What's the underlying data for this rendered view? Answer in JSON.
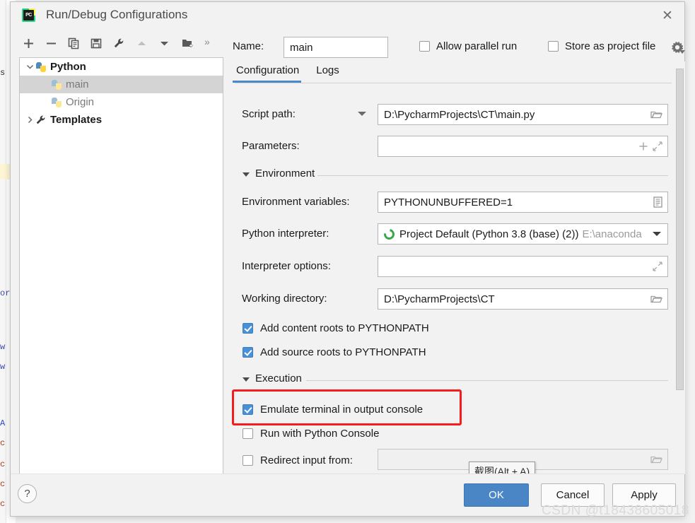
{
  "window": {
    "title": "Run/Debug Configurations",
    "app_icon": "pycharm-icon",
    "app_icon_text": "PC",
    "close_icon": "close-icon"
  },
  "toolbar": {
    "buttons": [
      {
        "name": "add-configuration-button",
        "icon": "plus-icon"
      },
      {
        "name": "remove-configuration-button",
        "icon": "minus-icon"
      },
      {
        "name": "copy-configuration-button",
        "icon": "copy-icon"
      },
      {
        "name": "save-configuration-button",
        "icon": "save-icon"
      },
      {
        "name": "edit-templates-button",
        "icon": "wrench-icon"
      },
      {
        "name": "move-up-button",
        "icon": "arrow-up-icon"
      },
      {
        "name": "move-down-button",
        "icon": "arrow-down-icon"
      },
      {
        "name": "new-folder-button",
        "icon": "new-folder-icon"
      }
    ],
    "overflow_label": "»"
  },
  "header": {
    "name_label": "Name:",
    "name_value": "main",
    "name_placeholder": "",
    "allow_parallel_run_label": "Allow parallel run",
    "allow_parallel_run_checked": false,
    "store_as_project_file_label": "Store as project file",
    "store_as_project_file_checked": false,
    "gear_icon": "gear-icon"
  },
  "tree": {
    "items": [
      {
        "label": "Python",
        "depth": 0,
        "twisty": "chevron-down",
        "icon": "python-icon",
        "selected": false,
        "bold": true
      },
      {
        "label": "main",
        "depth": 1,
        "twisty": "",
        "icon": "python-icon-dim",
        "selected": true,
        "bold": false
      },
      {
        "label": "Origin",
        "depth": 1,
        "twisty": "",
        "icon": "python-icon-dim",
        "selected": false,
        "bold": false
      },
      {
        "label": "Templates",
        "depth": 0,
        "twisty": "chevron-right",
        "icon": "wrench-icon",
        "selected": false,
        "bold": true
      }
    ]
  },
  "tabs": [
    {
      "label": "Configuration",
      "active": true
    },
    {
      "label": "Logs",
      "active": false
    }
  ],
  "form": {
    "script_path": {
      "label": "Script path:",
      "value": "D:\\PycharmProjects\\CT\\main.py",
      "combo_icon": "chevron-down-icon",
      "browse_icon": "folder-icon"
    },
    "parameters": {
      "label": "Parameters:",
      "value": "",
      "macro_icon": "plus-icon",
      "expand_icon": "expand-icon"
    },
    "environment_section": {
      "title": "Environment",
      "expanded": true,
      "twisty_icon": "triangle-down-icon"
    },
    "environment_variables": {
      "label": "Environment variables:",
      "value": "PYTHONUNBUFFERED=1",
      "browse_icon": "list-edit-icon"
    },
    "python_interpreter": {
      "label": "Python interpreter:",
      "value": "Project Default (Python 3.8 (base) (2))",
      "value_path": "E:\\anaconda",
      "status_icon": "conda-circle-icon",
      "dropdown_icon": "chevron-down-icon"
    },
    "interpreter_options": {
      "label": "Interpreter options:",
      "value": "",
      "expand_icon": "expand-icon"
    },
    "working_directory": {
      "label": "Working directory:",
      "value": "D:\\PycharmProjects\\CT",
      "browse_icon": "folder-icon"
    },
    "add_content_roots": {
      "label": "Add content roots to PYTHONPATH",
      "checked": true
    },
    "add_source_roots": {
      "label": "Add source roots to PYTHONPATH",
      "checked": true
    },
    "execution_section": {
      "title": "Execution",
      "expanded": true,
      "twisty_icon": "triangle-down-icon"
    },
    "emulate_terminal": {
      "label": "Emulate terminal in output console",
      "checked": true,
      "highlighted": true
    },
    "run_with_python_console": {
      "label": "Run with Python Console",
      "checked": false
    },
    "redirect_input": {
      "label": "Redirect input from:",
      "checked": false,
      "value": "",
      "browse_icon": "folder-icon"
    }
  },
  "tooltip": {
    "text": "截图(Alt + A)"
  },
  "footer": {
    "help_label": "?",
    "ok_label": "OK",
    "cancel_label": "Cancel",
    "apply_label": "Apply"
  },
  "watermark": {
    "text": "CSDN @t18438605018"
  },
  "background_editor": {
    "fragments": [
      "s",
      "or",
      "w",
      "w",
      "A",
      "c",
      "c",
      "c",
      "c"
    ]
  },
  "colors": {
    "accent": "#4a86c5",
    "annotation": "#f41c1c",
    "checkbox_checked": "#4a90d9",
    "selection": "#d4d4d4",
    "tab_underline": "#4a88c7"
  }
}
